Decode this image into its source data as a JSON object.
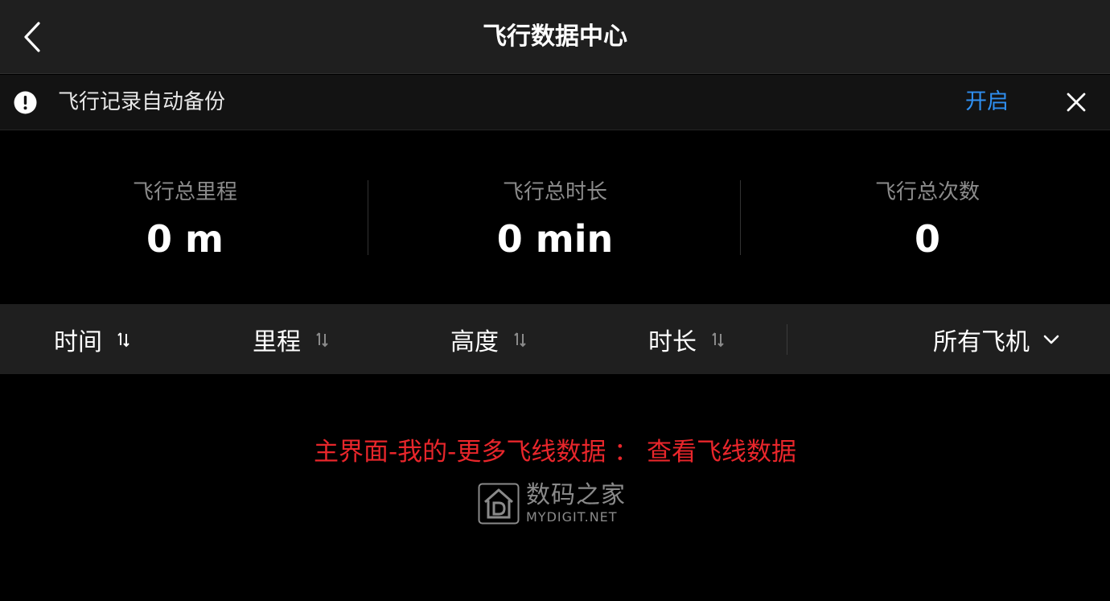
{
  "header": {
    "title": "飞行数据中心"
  },
  "notice": {
    "text": "飞行记录自动备份",
    "action_label": "开启"
  },
  "stats": [
    {
      "label": "飞行总里程",
      "value": "0 m"
    },
    {
      "label": "飞行总时长",
      "value": "0 min"
    },
    {
      "label": "飞行总次数",
      "value": "0"
    }
  ],
  "sort": {
    "items": [
      {
        "label": "时间"
      },
      {
        "label": "里程"
      },
      {
        "label": "高度"
      },
      {
        "label": "时长"
      }
    ],
    "aircraft_filter": "所有飞机"
  },
  "hint": "主界面-我的-更多飞线数据 ： 查看飞线数据",
  "watermark": {
    "name_cn": "数码之家",
    "name_en": "MYDIGIT.NET"
  },
  "colors": {
    "accent": "#2f8ff0",
    "hint": "#e8262b",
    "header_bg": "#1f1f1f",
    "background": "#000000"
  },
  "icons": {
    "back": "chevron-left-icon",
    "notice": "exclamation-circle-icon",
    "close": "close-icon",
    "sort": "sort-arrows-icon",
    "dropdown": "chevron-down-icon",
    "watermark_logo": "house-d-logo-icon"
  }
}
